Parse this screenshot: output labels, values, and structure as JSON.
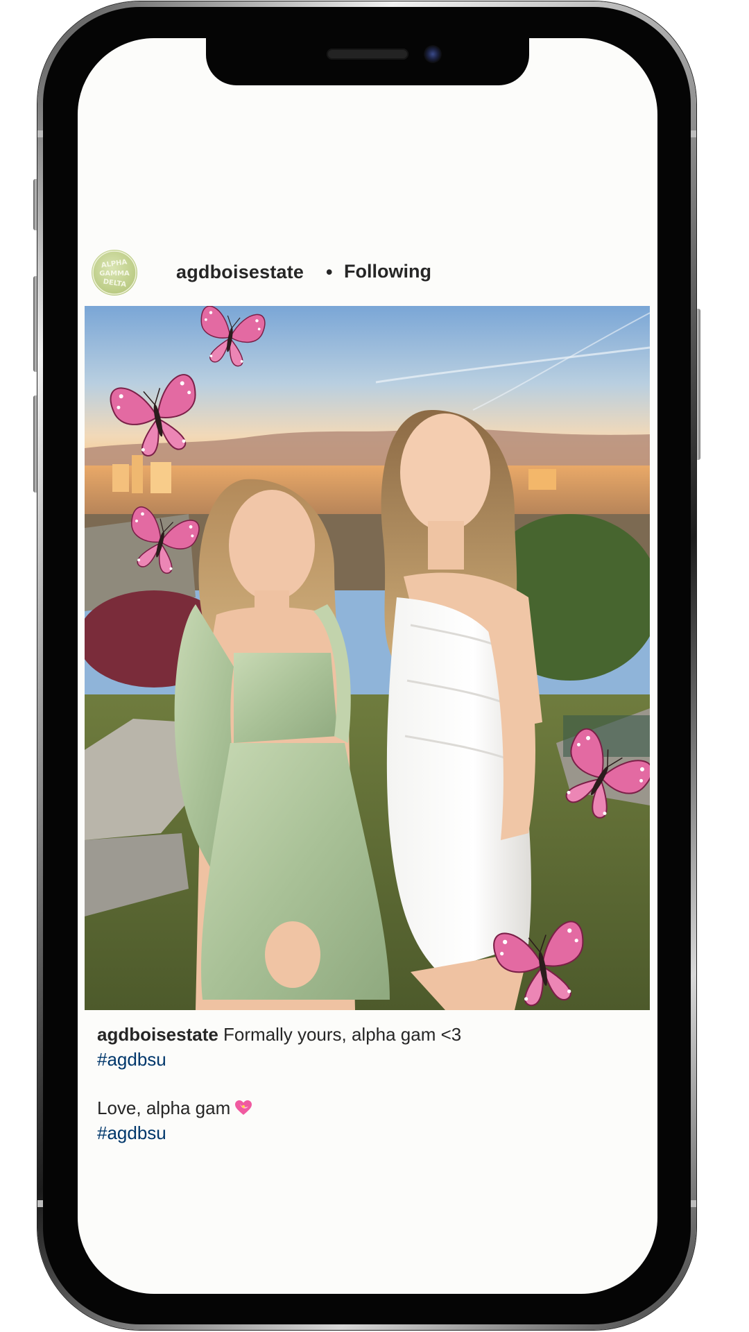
{
  "post": {
    "username": "agdboisestate",
    "separator": "•",
    "follow_label": "Following",
    "avatar_icon": "alpha-gamma-delta-logo",
    "avatar_text": "ALPHA GAMMA DELTA",
    "image_icon": "photo-two-women-with-butterflies"
  },
  "caption": {
    "username": "agdboisestate",
    "text": " Formally yours, alpha gam <3",
    "hashtag_1": "#agdbsu",
    "line_2": "Love, alpha gam",
    "emoji_icon": "heart-with-ribbon-icon",
    "hashtag_2": "#agdbsu"
  },
  "colors": {
    "text": "#262626",
    "hashtag": "#00376b",
    "background": "#fcfcfa",
    "butterfly": "#e36aa2"
  }
}
